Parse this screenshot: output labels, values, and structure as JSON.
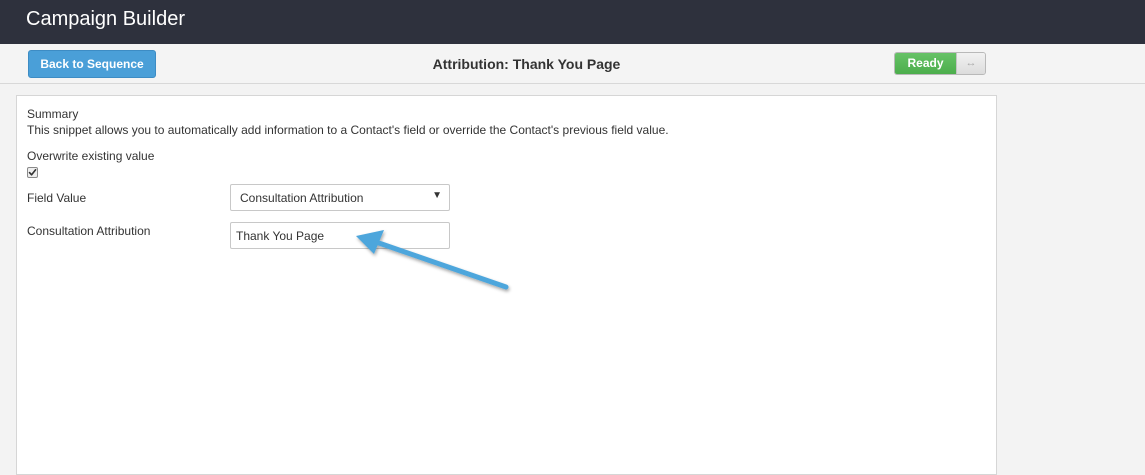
{
  "app": {
    "title": "Campaign Builder"
  },
  "toolbar": {
    "back_label": "Back to Sequence",
    "step_title": "Attribution: Thank You Page",
    "status_label": "Ready",
    "toggle_handle": "↔"
  },
  "form": {
    "summary_heading": "Summary",
    "summary_text": "This snippet allows you to automatically add information to a Contact's field or override the Contact's previous field value.",
    "overwrite_label": "Overwrite existing value",
    "overwrite_checked": true,
    "field_value_label": "Field Value",
    "field_value_selected": "Consultation Attribution",
    "attribution_label": "Consultation Attribution",
    "attribution_value": "Thank You Page"
  },
  "colors": {
    "header_bg": "#2e313d",
    "button_blue": "#4a9fd8",
    "ready_green": "#5cb85c",
    "annotation_arrow": "#4ea6dc"
  },
  "icons": {
    "select_caret": "chevron-down-icon",
    "toggle": "arrows-horizontal-icon",
    "checkbox": "checkmark-icon",
    "annotation": "arrow-annotation-icon"
  }
}
